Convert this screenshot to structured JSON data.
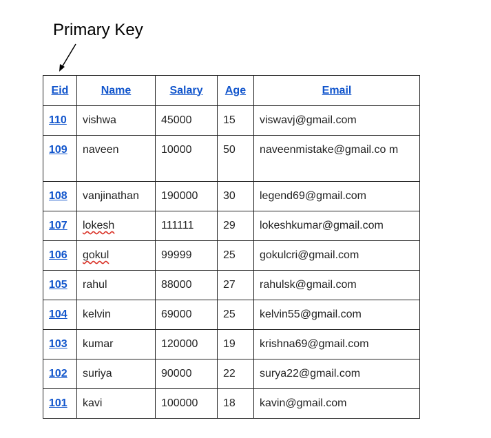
{
  "annotation": {
    "label": "Primary Key"
  },
  "table": {
    "headers": {
      "eid": "Eid",
      "name": "Name",
      "salary": "Salary",
      "age": "Age",
      "email": "Email"
    },
    "rows": [
      {
        "eid": "110",
        "name": "vishwa",
        "salary": "45000",
        "age": "15",
        "email": "viswavj@gmail.com"
      },
      {
        "eid": "109",
        "name": "naveen",
        "salary": "10000",
        "age": "50",
        "email": "naveenmistake@gmail.co m"
      },
      {
        "eid": "108",
        "name": "vanjinathan",
        "salary": "190000",
        "age": "30",
        "email": "legend69@gmail.com"
      },
      {
        "eid": "107",
        "name": "lokesh",
        "salary": "111111",
        "age": "29",
        "email": "lokeshkumar@gmail.com"
      },
      {
        "eid": "106",
        "name": "gokul",
        "salary": "99999",
        "age": "25",
        "email": "gokulcri@gmail.com"
      },
      {
        "eid": "105",
        "name": "rahul",
        "salary": "88000",
        "age": "27",
        "email": "rahulsk@gmail.com"
      },
      {
        "eid": "104",
        "name": "kelvin",
        "salary": "69000",
        "age": "25",
        "email": "kelvin55@gmail.com"
      },
      {
        "eid": "103",
        "name": "kumar",
        "salary": "120000",
        "age": "19",
        "email": "krishna69@gmail.com"
      },
      {
        "eid": "102",
        "name": "suriya",
        "salary": "90000",
        "age": "22",
        "email": "surya22@gmail.com"
      },
      {
        "eid": "101",
        "name": "kavi",
        "salary": "100000",
        "age": "18",
        "email": "kavin@gmail.com"
      }
    ]
  },
  "colors": {
    "link": "#1155cc",
    "text": "#222222",
    "border": "#222222",
    "spellcheck": "#d93025"
  }
}
